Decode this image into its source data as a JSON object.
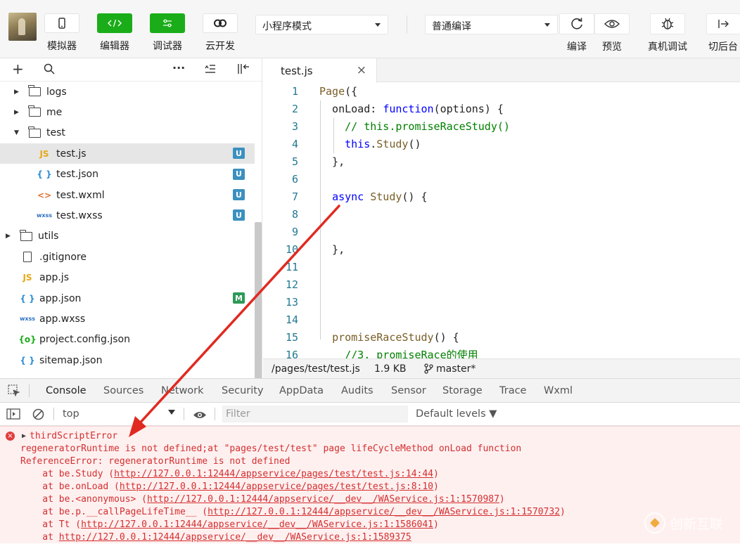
{
  "toolbar": {
    "buttons": [
      {
        "label": "模拟器",
        "icon": "phone-icon"
      },
      {
        "label": "编辑器",
        "icon": "code-icon"
      },
      {
        "label": "调试器",
        "icon": "sliders-icon"
      },
      {
        "label": "云开发",
        "icon": "cloud-icon"
      }
    ],
    "mode_select": "小程序模式",
    "compile_select": "普通编译",
    "right_buttons": [
      {
        "label": "编译",
        "icon": "refresh-icon"
      },
      {
        "label": "预览",
        "icon": "eye-icon"
      },
      {
        "label": "真机调试",
        "icon": "bug-icon"
      },
      {
        "label": "切后台",
        "icon": "switch-background-icon"
      }
    ],
    "accent_color": "#1aad19"
  },
  "sidebar": {
    "tree": [
      {
        "name": "logs",
        "type": "folder",
        "expanded": false,
        "depth": 1
      },
      {
        "name": "me",
        "type": "folder",
        "expanded": false,
        "depth": 1
      },
      {
        "name": "test",
        "type": "folder",
        "expanded": true,
        "depth": 1
      },
      {
        "name": "test.js",
        "type": "js",
        "prefix": "JS",
        "badge": "U",
        "active": true,
        "depth": 2
      },
      {
        "name": "test.json",
        "type": "json",
        "prefix": "{ }",
        "badge": "U",
        "depth": 2
      },
      {
        "name": "test.wxml",
        "type": "wxml",
        "prefix": "<>",
        "badge": "U",
        "depth": 2
      },
      {
        "name": "test.wxss",
        "type": "wxss",
        "prefix": "wxss",
        "badge": "U",
        "depth": 2
      },
      {
        "name": "utils",
        "type": "folder",
        "expanded": false,
        "depth": 0
      },
      {
        "name": ".gitignore",
        "type": "file",
        "depth": 0
      },
      {
        "name": "app.js",
        "type": "js",
        "prefix": "JS",
        "depth": 0
      },
      {
        "name": "app.json",
        "type": "json",
        "prefix": "{ }",
        "badge": "M",
        "depth": 0
      },
      {
        "name": "app.wxss",
        "type": "wxss",
        "prefix": "wxss",
        "depth": 0
      },
      {
        "name": "project.config.json",
        "type": "config",
        "prefix": "{o}",
        "depth": 0
      },
      {
        "name": "sitemap.json",
        "type": "json",
        "prefix": "{ }",
        "depth": 0
      }
    ]
  },
  "editor": {
    "tab": "test.js",
    "lines": [
      {
        "n": "1",
        "text": "Page({"
      },
      {
        "n": "2",
        "text": "  onLoad: function(options) {"
      },
      {
        "n": "3",
        "text": "    // this.promiseRaceStudy()"
      },
      {
        "n": "4",
        "text": "    this.Study()"
      },
      {
        "n": "5",
        "text": "  },"
      },
      {
        "n": "6",
        "text": ""
      },
      {
        "n": "7",
        "text": "  async Study() {"
      },
      {
        "n": "8",
        "text": ""
      },
      {
        "n": "9",
        "text": ""
      },
      {
        "n": "10",
        "text": "  },"
      },
      {
        "n": "11",
        "text": ""
      },
      {
        "n": "12",
        "text": ""
      },
      {
        "n": "13",
        "text": ""
      },
      {
        "n": "14",
        "text": ""
      },
      {
        "n": "15",
        "text": "  promiseRaceStudy() {"
      },
      {
        "n": "16",
        "text": "    //3. promiseRace的使用"
      }
    ],
    "status": {
      "path": "/pages/test/test.js",
      "size": "1.9 KB",
      "branch": "master*"
    }
  },
  "devtools": {
    "tabs": [
      "Console",
      "Sources",
      "Network",
      "Security",
      "AppData",
      "Audits",
      "Sensor",
      "Storage",
      "Trace",
      "Wxml"
    ],
    "active_tab": "Console",
    "context": "top",
    "filter_placeholder": "Filter",
    "levels": "Default levels ▼",
    "error_title": "thirdScriptError",
    "error_lines": [
      "regeneratorRuntime is not defined;at \"pages/test/test\" page lifeCycleMethod onLoad function",
      "ReferenceError: regeneratorRuntime is not defined"
    ],
    "stack": [
      {
        "prefix": "    at be.Study (",
        "link": "http://127.0.0.1:12444/appservice/pages/test/test.js:14:44",
        "suffix": ")"
      },
      {
        "prefix": "    at be.onLoad (",
        "link": "http://127.0.0.1:12444/appservice/pages/test/test.js:8:10",
        "suffix": ")"
      },
      {
        "prefix": "    at be.<anonymous> (",
        "link": "http://127.0.0.1:12444/appservice/__dev__/WAService.js:1:1570987",
        "suffix": ")"
      },
      {
        "prefix": "    at be.p.__callPageLifeTime__ (",
        "link": "http://127.0.0.1:12444/appservice/__dev__/WAService.js:1:1570732",
        "suffix": ")"
      },
      {
        "prefix": "    at Tt (",
        "link": "http://127.0.0.1:12444/appservice/__dev__/WAService.js:1:1586041",
        "suffix": ")"
      },
      {
        "prefix": "    at ",
        "link": "http://127.0.0.1:12444/appservice/__dev__/WAService.js:1:1589375",
        "suffix": ""
      }
    ],
    "error_color": "#d32f2f"
  },
  "watermark": "创新互联"
}
